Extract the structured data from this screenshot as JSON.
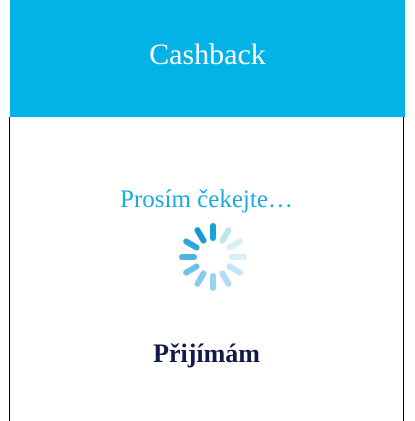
{
  "header": {
    "title": "Cashback",
    "background_color": "#03b2e6"
  },
  "main": {
    "wait_message": "Prosím čekejte…",
    "status_message": "Přijímám",
    "spinner_icon": "loading-spinner-icon",
    "accent_color": "#1aabdf"
  }
}
